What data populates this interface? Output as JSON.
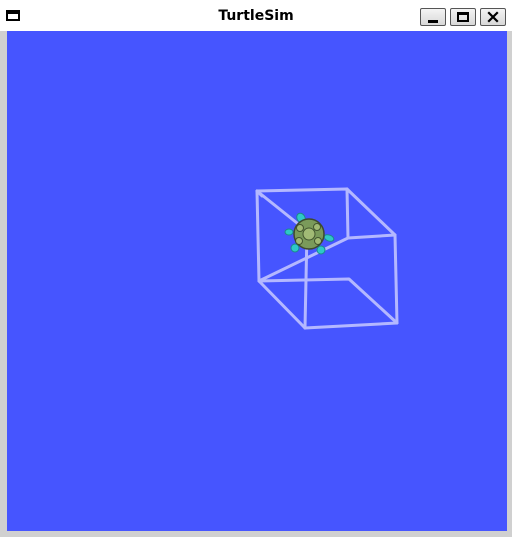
{
  "window": {
    "title": "TurtleSim",
    "buttons": {
      "minimize_icon": "minimize-icon",
      "maximize_icon": "maximize-icon",
      "close_icon": "close-icon"
    }
  },
  "canvas": {
    "background_color": "#4655ff",
    "pen_color": "#b4b8ff",
    "turtle": {
      "shell_color": "#7a9a5a",
      "limb_color": "#2ec8c8"
    }
  }
}
